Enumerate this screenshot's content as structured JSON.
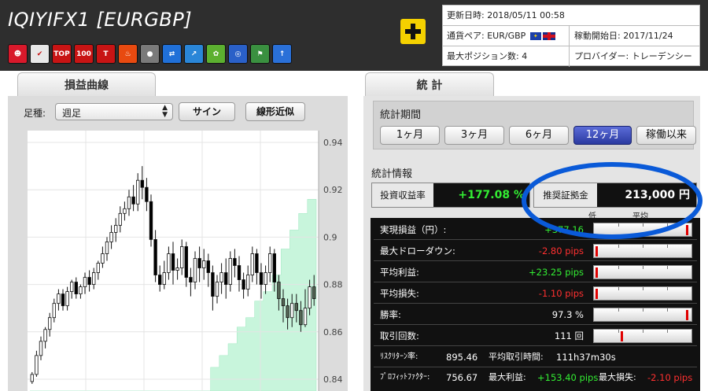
{
  "header": {
    "title": "IQIYIFX1 [EURGBP]",
    "icons": [
      {
        "name": "smile-icon",
        "color": "#d8192b",
        "glyph": "☻"
      },
      {
        "name": "chart-check-icon",
        "color": "#e8e8e8",
        "glyph": "✔"
      },
      {
        "name": "top100-icon",
        "color": "#c81414",
        "glyph": "TOP"
      },
      {
        "name": "rocket-100-icon",
        "color": "#c81414",
        "glyph": "100"
      },
      {
        "name": "t100-icon",
        "color": "#c81414",
        "glyph": "T"
      },
      {
        "name": "fire-icon",
        "color": "#e84a10",
        "glyph": "♨"
      },
      {
        "name": "sphere-icon",
        "color": "#7a7a7a",
        "glyph": "●"
      },
      {
        "name": "shuffle-icon",
        "color": "#2070d8",
        "glyph": "⇄"
      },
      {
        "name": "growth-chart-icon",
        "color": "#2a86d8",
        "glyph": "↗"
      },
      {
        "name": "sprout-icon",
        "color": "#5cb030",
        "glyph": "✿"
      },
      {
        "name": "target-icon",
        "color": "#2a60c8",
        "glyph": "◎"
      },
      {
        "name": "flag-chart-icon",
        "color": "#3a9040",
        "glyph": "⚑"
      },
      {
        "name": "up-arrow-icon",
        "color": "#2a70d8",
        "glyph": "↑"
      }
    ]
  },
  "info": {
    "updated_label": "更新日時:",
    "updated_value": "2018/05/11 00:58",
    "pair_label": "通貨ペア:",
    "pair_value": "EUR/GBP",
    "start_label": "稼動開始日:",
    "start_value": "2017/11/24",
    "max_pos_label": "最大ポジション数:",
    "max_pos_value": "4",
    "provider_label": "プロバイダー:",
    "provider_value": "トレーデンシー"
  },
  "left_panel": {
    "tab_label": "損益曲線",
    "foot_label": "足種:",
    "foot_select": "週足",
    "sign_button": "サイン",
    "linear_button": "線形近似"
  },
  "chart_data": {
    "type": "candlestick",
    "ylim": [
      0.835,
      0.945
    ],
    "yticks": [
      "0.94",
      "0.92",
      "0.9",
      "0.88",
      "0.86",
      "0.84"
    ],
    "ytick_values": [
      0.94,
      0.92,
      0.9,
      0.88,
      0.86,
      0.84
    ],
    "candles": [
      [
        0.839,
        0.842,
        0.838,
        0.843
      ],
      [
        0.842,
        0.85,
        0.841,
        0.852
      ],
      [
        0.85,
        0.856,
        0.848,
        0.858
      ],
      [
        0.856,
        0.861,
        0.853,
        0.862
      ],
      [
        0.861,
        0.866,
        0.858,
        0.868
      ],
      [
        0.866,
        0.872,
        0.864,
        0.874
      ],
      [
        0.872,
        0.876,
        0.869,
        0.878
      ],
      [
        0.876,
        0.871,
        0.869,
        0.878
      ],
      [
        0.871,
        0.877,
        0.869,
        0.879
      ],
      [
        0.877,
        0.881,
        0.874,
        0.882
      ],
      [
        0.881,
        0.876,
        0.874,
        0.883
      ],
      [
        0.876,
        0.879,
        0.874,
        0.88
      ],
      [
        0.879,
        0.883,
        0.876,
        0.885
      ],
      [
        0.883,
        0.88,
        0.877,
        0.886
      ],
      [
        0.88,
        0.885,
        0.878,
        0.887
      ],
      [
        0.885,
        0.889,
        0.882,
        0.89
      ],
      [
        0.889,
        0.893,
        0.887,
        0.896
      ],
      [
        0.893,
        0.898,
        0.89,
        0.9
      ],
      [
        0.898,
        0.902,
        0.895,
        0.905
      ],
      [
        0.902,
        0.905,
        0.898,
        0.908
      ],
      [
        0.905,
        0.91,
        0.902,
        0.913
      ],
      [
        0.91,
        0.912,
        0.907,
        0.915
      ],
      [
        0.912,
        0.917,
        0.909,
        0.92
      ],
      [
        0.917,
        0.914,
        0.911,
        0.922
      ],
      [
        0.914,
        0.924,
        0.911,
        0.927
      ],
      [
        0.924,
        0.921,
        0.916,
        0.93
      ],
      [
        0.921,
        0.915,
        0.911,
        0.925
      ],
      [
        0.915,
        0.899,
        0.896,
        0.918
      ],
      [
        0.899,
        0.884,
        0.881,
        0.903
      ],
      [
        0.884,
        0.88,
        0.877,
        0.888
      ],
      [
        0.88,
        0.885,
        0.878,
        0.89
      ],
      [
        0.885,
        0.893,
        0.882,
        0.896
      ],
      [
        0.893,
        0.886,
        0.88,
        0.898
      ],
      [
        0.886,
        0.887,
        0.882,
        0.891
      ],
      [
        0.887,
        0.896,
        0.884,
        0.899
      ],
      [
        0.896,
        0.883,
        0.879,
        0.898
      ],
      [
        0.883,
        0.881,
        0.875,
        0.887
      ],
      [
        0.881,
        0.891,
        0.878,
        0.894
      ],
      [
        0.891,
        0.887,
        0.881,
        0.896
      ],
      [
        0.887,
        0.89,
        0.882,
        0.895
      ],
      [
        0.89,
        0.885,
        0.879,
        0.893
      ],
      [
        0.885,
        0.875,
        0.869,
        0.888
      ],
      [
        0.875,
        0.881,
        0.872,
        0.884
      ],
      [
        0.881,
        0.885,
        0.876,
        0.889
      ],
      [
        0.885,
        0.88,
        0.874,
        0.891
      ],
      [
        0.88,
        0.891,
        0.877,
        0.894
      ],
      [
        0.891,
        0.888,
        0.883,
        0.895
      ],
      [
        0.888,
        0.882,
        0.877,
        0.892
      ],
      [
        0.882,
        0.878,
        0.874,
        0.885
      ],
      [
        0.878,
        0.884,
        0.875,
        0.888
      ],
      [
        0.884,
        0.893,
        0.881,
        0.896
      ],
      [
        0.893,
        0.885,
        0.88,
        0.895
      ],
      [
        0.885,
        0.88,
        0.874,
        0.889
      ],
      [
        0.88,
        0.885,
        0.876,
        0.888
      ],
      [
        0.885,
        0.893,
        0.881,
        0.896
      ],
      [
        0.893,
        0.881,
        0.877,
        0.895
      ],
      [
        0.881,
        0.874,
        0.869,
        0.884
      ],
      [
        0.874,
        0.871,
        0.864,
        0.878
      ],
      [
        0.871,
        0.866,
        0.861,
        0.874
      ],
      [
        0.866,
        0.872,
        0.862,
        0.876
      ],
      [
        0.872,
        0.869,
        0.864,
        0.876
      ],
      [
        0.869,
        0.863,
        0.86,
        0.873
      ],
      [
        0.863,
        0.87,
        0.862,
        0.878
      ],
      [
        0.87,
        0.879,
        0.867,
        0.882
      ],
      [
        0.879,
        0.874,
        0.871,
        0.884
      ]
    ],
    "margin_fill": [
      0.835,
      0.835,
      0.835,
      0.835,
      0.835,
      0.835,
      0.835,
      0.835,
      0.835,
      0.835,
      0.835,
      0.835,
      0.835,
      0.835,
      0.835,
      0.835,
      0.835,
      0.835,
      0.835,
      0.835,
      0.835,
      0.835,
      0.835,
      0.835,
      0.835,
      0.835,
      0.835,
      0.835,
      0.835,
      0.835,
      0.835,
      0.835,
      0.835,
      0.835,
      0.835,
      0.835,
      0.835,
      0.835,
      0.835,
      0.835,
      0.835,
      0.845,
      0.845,
      0.85,
      0.85,
      0.855,
      0.855,
      0.862,
      0.862,
      0.866,
      0.866,
      0.873,
      0.873,
      0.877,
      0.877,
      0.884,
      0.884,
      0.895,
      0.895,
      0.903,
      0.903,
      0.91,
      0.91,
      0.916,
      0.916
    ]
  },
  "right_panel": {
    "tab_label": "統 計",
    "period_label": "統計期間",
    "period_buttons": [
      "1ヶ月",
      "3ヶ月",
      "6ヶ月",
      "12ヶ月",
      "稼働以来"
    ],
    "selected_period": "12ヶ月",
    "info_label": "統計情報",
    "roi_label": "投資収益率",
    "roi_value": "+177.08 %",
    "margin_label": "推奨証拠金",
    "margin_value": "213,000 円",
    "scale_low": "低",
    "scale_avg": "平均",
    "rows": [
      {
        "label": "実現損益（円）:",
        "value": "+377,16",
        "tone": "green",
        "level": 0.97
      },
      {
        "label": "最大ドローダウン:",
        "value": "-2.80 pips",
        "tone": "red",
        "level": 0.02
      },
      {
        "label": "平均利益:",
        "value": "+23.25 pips",
        "tone": "green",
        "level": 0.02
      },
      {
        "label": "平均損失:",
        "value": "-1.10 pips",
        "tone": "red",
        "level": 0.02
      },
      {
        "label": "勝率:",
        "value": "97.3 %",
        "tone": "white",
        "level": 0.97
      },
      {
        "label": "取引回数:",
        "value": "111 回",
        "tone": "white",
        "level": 0.28
      }
    ],
    "bottom": {
      "risk_return_label": "ﾘｽｸﾘﾀｰﾝ率:",
      "risk_return_value": "895.46",
      "avg_time_label": "平均取引時間:",
      "avg_time_value": "111h37m30s",
      "profit_factor_label": "ﾌﾟﾛﾌｨｯﾄﾌｧｸﾀｰ:",
      "profit_factor_value": "756.67",
      "max_profit_label": "最大利益:",
      "max_profit_value": "+153.40 pips",
      "max_loss_label": "最大損失:",
      "max_loss_value": "-2.10 pips"
    }
  },
  "colors": {
    "highlight_ring": "#0a5ad8",
    "candle_up": "#ffffff",
    "candle_down": "#000000",
    "margin_fill": "#c8f5dc"
  }
}
